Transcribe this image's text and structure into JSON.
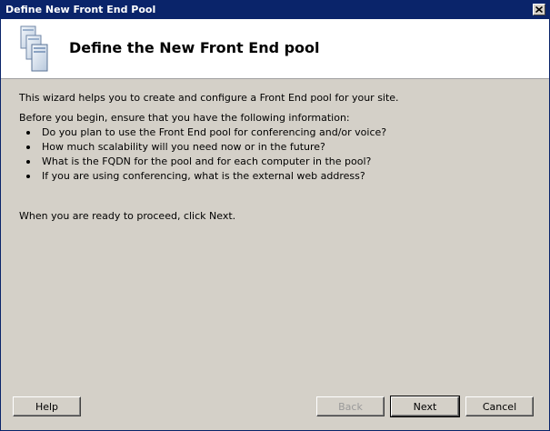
{
  "window": {
    "title": "Define New Front End Pool"
  },
  "header": {
    "title": "Define the New Front End pool",
    "icon": "server-pool-icon"
  },
  "body": {
    "intro": "This wizard helps you to create and configure a Front End pool for your site.",
    "before": "Before you begin, ensure that you have the following information:",
    "bullets": [
      "Do you plan to use the Front End pool for conferencing and/or voice?",
      "How much scalability will you need now or in the future?",
      "What is the FQDN for the pool and for each computer in the pool?",
      "If you are using conferencing, what is the external web address?"
    ],
    "proceed": "When you are ready to proceed, click Next."
  },
  "buttons": {
    "help": "Help",
    "back": "Back",
    "next": "Next",
    "cancel": "Cancel"
  }
}
